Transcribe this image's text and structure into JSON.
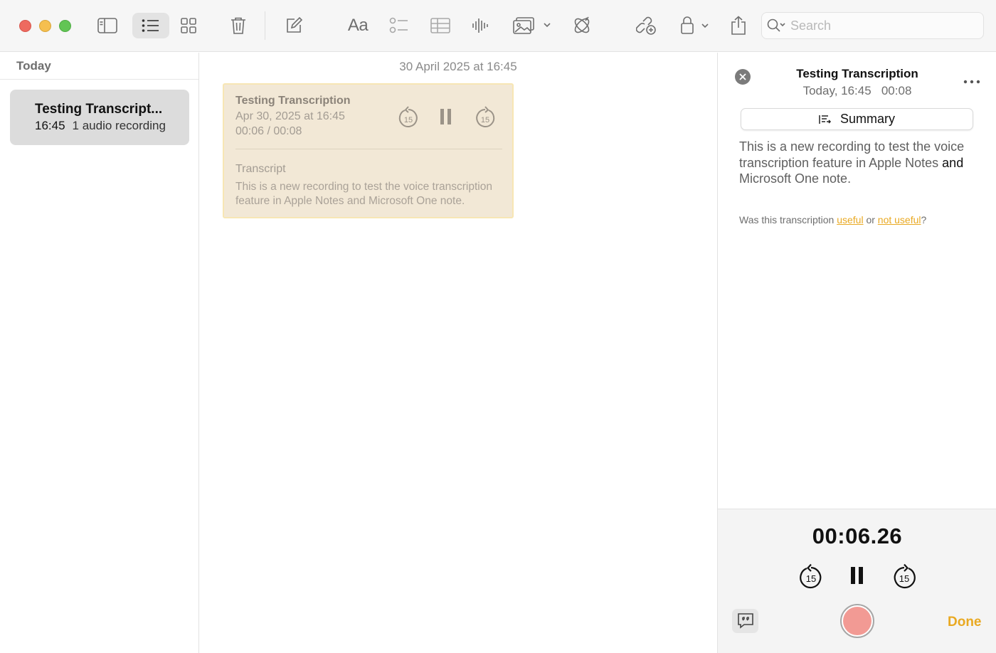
{
  "toolbar": {
    "icons": [
      "sidebar-icon",
      "list-view-icon",
      "gallery-view-icon",
      "trash-icon",
      "compose-icon",
      "format-text-icon",
      "checklist-icon",
      "table-icon",
      "audio-waveform-icon",
      "media-icon",
      "apple-intelligence-icon",
      "collaborate-icon",
      "lock-icon",
      "share-icon"
    ],
    "format_label": "Aa",
    "search_placeholder": "Search"
  },
  "sidebar": {
    "section_header": "Today",
    "notes": [
      {
        "title": "Testing Transcript...",
        "time": "16:45",
        "preview": "1 audio recording"
      }
    ]
  },
  "editor": {
    "date_header": "30 April 2025 at 16:45",
    "recording_card": {
      "title": "Testing Transcription",
      "date": "Apr 30, 2025 at 16:45",
      "progress": "00:06 / 00:08",
      "skip_back_label": "15",
      "skip_forward_label": "15",
      "transcript_label": "Transcript",
      "transcript_preview": "This is a new recording to test the voice transcription feature in Apple Notes and Microsoft One note."
    }
  },
  "panel": {
    "title": "Testing Transcription",
    "subtitle": "Today, 16:45   00:08",
    "summary_label": "Summary",
    "transcript_part1": "This is a new recording to test the voice transcription feature in Apple Notes ",
    "transcript_and": "and",
    "transcript_part2": " Microsoft One note.",
    "feedback_prefix": "Was this transcription ",
    "feedback_useful": "useful",
    "feedback_or": " or ",
    "feedback_not_useful": "not useful",
    "feedback_suffix": "?",
    "player": {
      "timer": "00:06.26",
      "skip_back_label": "15",
      "skip_forward_label": "15",
      "done_label": "Done"
    }
  },
  "colors": {
    "accent": "#e9a922",
    "record": "#f29a94",
    "card_bg": "#f2e8d6",
    "selection": "#dcdcdc"
  }
}
